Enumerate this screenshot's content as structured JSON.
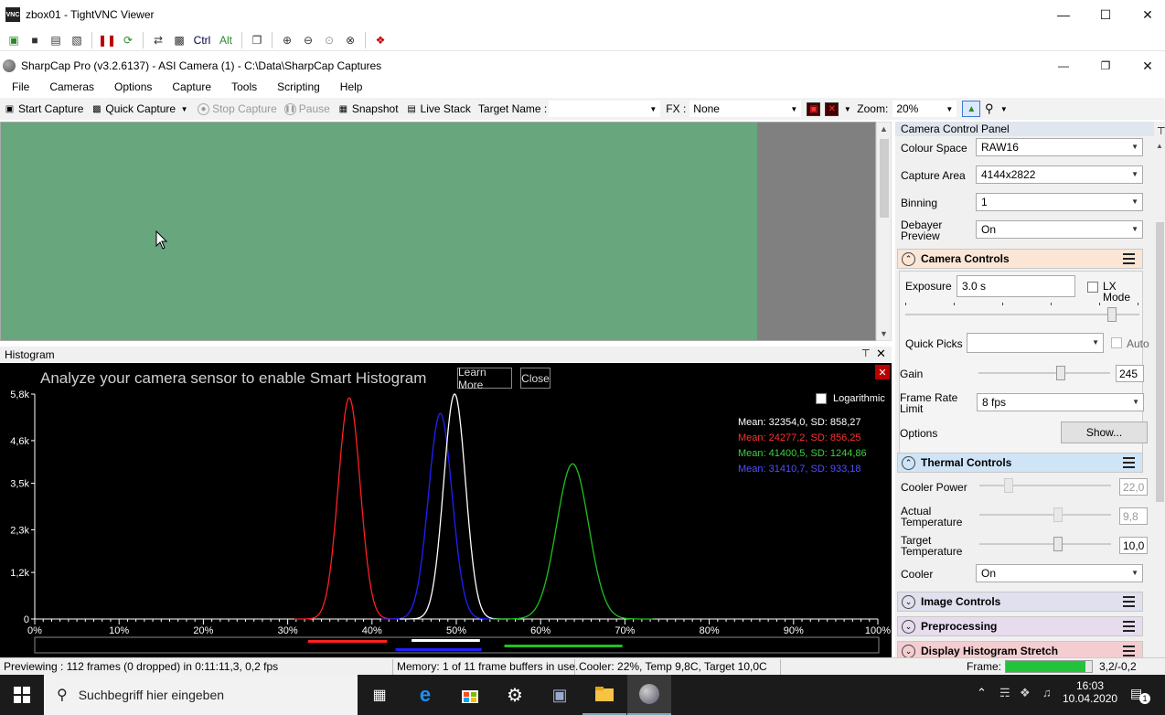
{
  "vnc": {
    "title": "zbox01 - TightVNC Viewer",
    "logo": "VNC",
    "toolbar_ctrl": "Ctrl",
    "toolbar_alt": "Alt"
  },
  "app": {
    "title": "SharpCap Pro (v3.2.6137) - ASI Camera (1) - C:\\Data\\SharpCap Captures"
  },
  "menu": [
    "File",
    "Cameras",
    "Options",
    "Capture",
    "Tools",
    "Scripting",
    "Help"
  ],
  "toolbar": {
    "start_capture": "Start Capture",
    "quick_capture": "Quick Capture",
    "stop_capture": "Stop Capture",
    "pause": "Pause",
    "snapshot": "Snapshot",
    "live_stack": "Live Stack",
    "target_name_label": "Target Name :",
    "target_name_value": "",
    "fx_label": "FX :",
    "fx_value": "None",
    "zoom_label": "Zoom:",
    "zoom_value": "20%"
  },
  "histogram": {
    "panel_title": "Histogram",
    "smart_message": "Analyze your camera sensor to enable Smart Histogram",
    "learn_more": "Learn More",
    "close": "Close",
    "logarithmic_label": "Logarithmic",
    "logarithmic_checked": false,
    "stats": [
      {
        "text": "Mean: 32354,0, SD: 858,27",
        "color": "#ffffff"
      },
      {
        "text": "Mean: 24277,2, SD: 856,25",
        "color": "#ff3030"
      },
      {
        "text": "Mean: 41400,5, SD: 1244,86",
        "color": "#40d040"
      },
      {
        "text": "Mean: 31410,7, SD: 933,18",
        "color": "#5050ff"
      }
    ]
  },
  "chart_data": {
    "type": "line",
    "x_ticks": [
      "0%",
      "10%",
      "20%",
      "30%",
      "40%",
      "50%",
      "60%",
      "70%",
      "80%",
      "90%",
      "100%"
    ],
    "y_ticks": [
      "0",
      "1,2k",
      "2,3k",
      "3,5k",
      "4,6k",
      "5,8k"
    ],
    "xlim": [
      0,
      100
    ],
    "ylim": [
      0,
      5800
    ],
    "series": [
      {
        "color": "#ff2020",
        "peak_x": 37.3,
        "peak_y": 5700,
        "sd": 1.3
      },
      {
        "color": "#2020ff",
        "peak_x": 48.1,
        "peak_y": 5300,
        "sd": 1.4
      },
      {
        "color": "#ffffff",
        "peak_x": 49.8,
        "peak_y": 5800,
        "sd": 1.3
      },
      {
        "color": "#20c020",
        "peak_x": 63.8,
        "peak_y": 4000,
        "sd": 1.9
      }
    ],
    "range_bars": [
      {
        "color": "#ff2020",
        "from": 32.4,
        "to": 41.8
      },
      {
        "color": "#ffffff",
        "from": 44.7,
        "to": 52.8
      },
      {
        "color": "#2020ff",
        "from": 42.8,
        "to": 53.0
      },
      {
        "color": "#20c020",
        "from": 55.7,
        "to": 69.7
      }
    ]
  },
  "ccp": {
    "title": "Camera Control Panel",
    "colour_space": {
      "label": "Colour Space",
      "value": "RAW16"
    },
    "capture_area": {
      "label": "Capture Area",
      "value": "4144x2822"
    },
    "binning": {
      "label": "Binning",
      "value": "1"
    },
    "debayer": {
      "label": "Debayer Preview",
      "value": "On"
    },
    "camera_controls": {
      "title": "Camera Controls",
      "exposure_label": "Exposure",
      "exposure_value": "3.0 s",
      "lx_mode": "LX Mode",
      "quick_picks": "Quick Picks",
      "auto": "Auto",
      "gain_label": "Gain",
      "gain_value": "245",
      "frame_rate_label": "Frame Rate Limit",
      "frame_rate_value": "8 fps",
      "options_label": "Options",
      "show_button": "Show..."
    },
    "thermal": {
      "title": "Thermal Controls",
      "cooler_power_label": "Cooler Power",
      "cooler_power_value": "22,0",
      "actual_temp_label": "Actual Temperature",
      "actual_temp_value": "9,8",
      "target_temp_label": "Target Temperature",
      "target_temp_value": "10,0",
      "cooler_label": "Cooler",
      "cooler_value": "On"
    },
    "image_controls": "Image Controls",
    "preprocessing": "Preprocessing",
    "display_stretch": "Display Histogram Stretch"
  },
  "status": {
    "previewing": "Previewing : 112 frames (0 dropped) in 0:11:11,3, 0,2 fps",
    "memory": "Memory: 1 of 11 frame buffers in use.",
    "cooler": "Cooler: 22%, Temp 9,8C, Target 10,0C",
    "frame_label": "Frame:",
    "coords": "3,2/-0,2"
  },
  "taskbar": {
    "search_placeholder": "Suchbegriff hier eingeben",
    "time": "16:03",
    "date": "10.04.2020",
    "notification_count": "1"
  }
}
